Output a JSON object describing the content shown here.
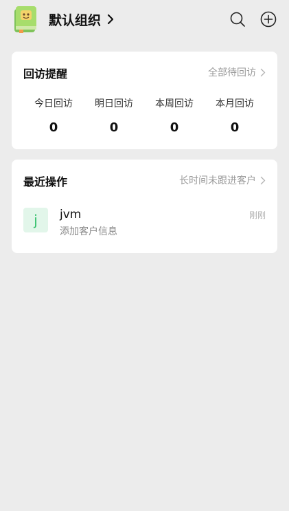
{
  "header": {
    "org_name": "默认组织"
  },
  "visit_reminder": {
    "title": "回访提醒",
    "link_label": "全部待回访",
    "stats": [
      {
        "label": "今日回访",
        "value": "0"
      },
      {
        "label": "明日回访",
        "value": "0"
      },
      {
        "label": "本周回访",
        "value": "0"
      },
      {
        "label": "本月回访",
        "value": "0"
      }
    ]
  },
  "recent": {
    "title": "最近操作",
    "link_label": "长时间未跟进客户",
    "items": [
      {
        "avatar_letter": "j",
        "name": "jvm",
        "desc": "添加客户信息",
        "time": "刚刚"
      }
    ]
  },
  "colors": {
    "background": "#ececec",
    "card": "#ffffff",
    "accent_green": "#2fbf68",
    "avatar_bg": "#e2f6ea"
  },
  "icons": [
    "book-logo-icon",
    "chevron-right-icon",
    "search-icon",
    "add-circle-icon"
  ]
}
